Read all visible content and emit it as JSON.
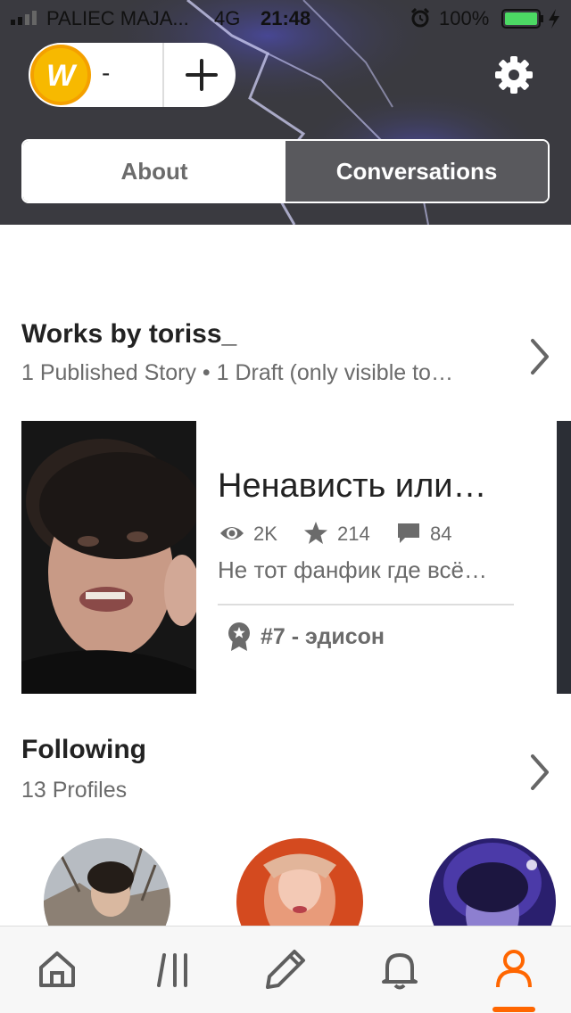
{
  "status_bar": {
    "carrier": "PALIEC MAJA...",
    "network": "4G",
    "time": "21:48",
    "battery": "100%"
  },
  "header": {
    "coin_minus": "-",
    "tabs": [
      {
        "label": "About",
        "active": false
      },
      {
        "label": "Conversations",
        "active": true
      }
    ]
  },
  "works": {
    "title": "Works by toriss_",
    "subtitle": "1 Published Story • 1 Draft (only visible to…",
    "story": {
      "title": "Ненависть или…",
      "reads": "2K",
      "votes": "214",
      "comments": "84",
      "description": "Не тот фанфик где всё…",
      "rank": "#7 - ",
      "rank_tag": "эдисон"
    }
  },
  "following": {
    "title": "Following",
    "subtitle": "13 Profiles"
  },
  "nav": {
    "items": [
      "home-icon",
      "library-icon",
      "write-icon",
      "notifications-icon",
      "profile-icon"
    ],
    "active": "profile-icon"
  },
  "colors": {
    "accent": "#ff6600",
    "header_bg": "#3a3a40",
    "tab_active": "#59595d",
    "battery": "#4cd964",
    "coin": "#f7b900"
  }
}
